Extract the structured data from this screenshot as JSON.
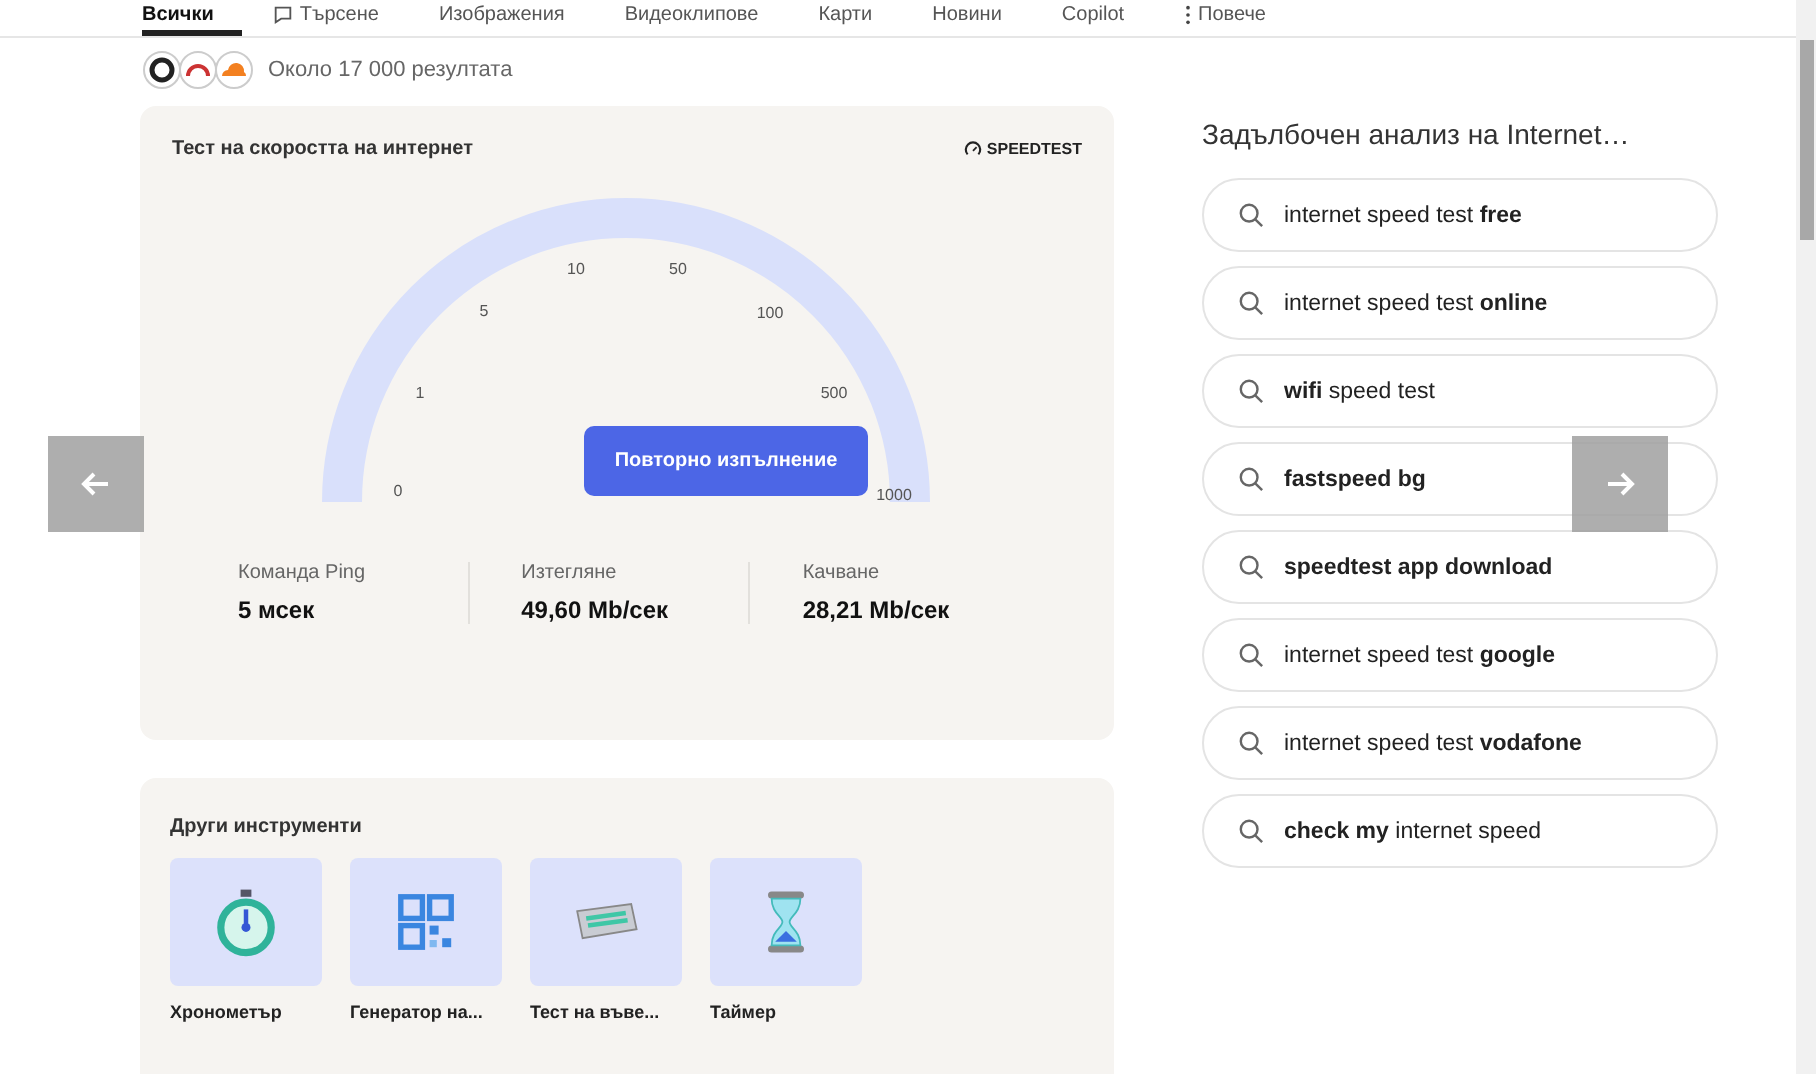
{
  "nav_tabs": [
    {
      "label": "Всички",
      "selected": true,
      "kind": "text"
    },
    {
      "label": "Търсене",
      "selected": false,
      "kind": "chat"
    },
    {
      "label": "Изображения",
      "selected": false,
      "kind": "text"
    },
    {
      "label": "Видеоклипове",
      "selected": false,
      "kind": "text"
    },
    {
      "label": "Карти",
      "selected": false,
      "kind": "text"
    },
    {
      "label": "Новини",
      "selected": false,
      "kind": "text"
    },
    {
      "label": "Copilot",
      "selected": false,
      "kind": "text"
    },
    {
      "label": "Повече",
      "selected": false,
      "kind": "more"
    }
  ],
  "results_count": "Около 17 000 резултата",
  "speed_card": {
    "title": "Тест на скоростта на интернет",
    "brand": "SPEEDTEST",
    "gauge_ticks": [
      "0",
      "1",
      "5",
      "10",
      "50",
      "100",
      "500",
      "1000"
    ],
    "rerun_button": "Повторно изпълнение",
    "stats": [
      {
        "label": "Команда Ping",
        "value": "5 мсек"
      },
      {
        "label": "Изтегляне",
        "value": "49,60 Mb/сек"
      },
      {
        "label": "Качване",
        "value": "28,21 Mb/сек"
      }
    ]
  },
  "tools_card": {
    "title": "Други инструменти",
    "tools": [
      {
        "label": "Хронометър",
        "kind": "stopwatch"
      },
      {
        "label": "Генератор на...",
        "kind": "qr"
      },
      {
        "label": "Тест на въве...",
        "kind": "keyboard"
      },
      {
        "label": "Таймер",
        "kind": "hourglass"
      }
    ]
  },
  "related": {
    "title": "Задълбочен анализ на Internet…",
    "suggestions": [
      "internet speed test **free**",
      "internet speed test **online**",
      "**wifi** speed test",
      "**fastspeed bg**",
      "**speedtest app download**",
      "internet speed test **google**",
      "internet speed test **vodafone**",
      "**check my** internet speed"
    ]
  }
}
